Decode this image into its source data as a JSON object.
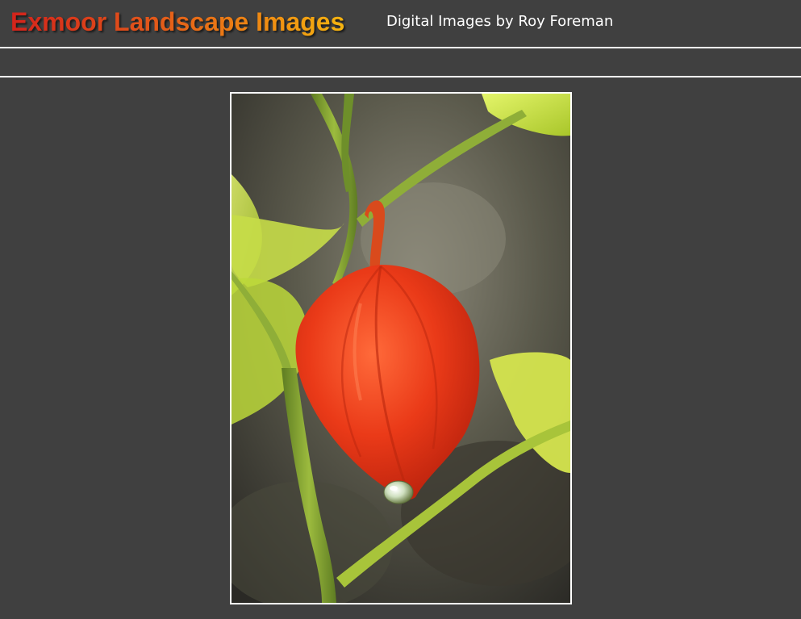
{
  "header": {
    "title": "Exmoor Landscape Images",
    "subtitle": "Digital Images by Roy Foreman"
  },
  "main": {
    "photo": {
      "subject": "chinese-lantern-physalis-with-water-droplet"
    }
  },
  "colors": {
    "background": "#404040",
    "rule": "#ffffff",
    "title_gradient_start": "#d3231b",
    "title_gradient_end": "#f5b410",
    "subtitle": "#ffffff",
    "lantern": "#e8381a",
    "leaf": "#c8df3c",
    "stem": "#7a9a2e"
  }
}
